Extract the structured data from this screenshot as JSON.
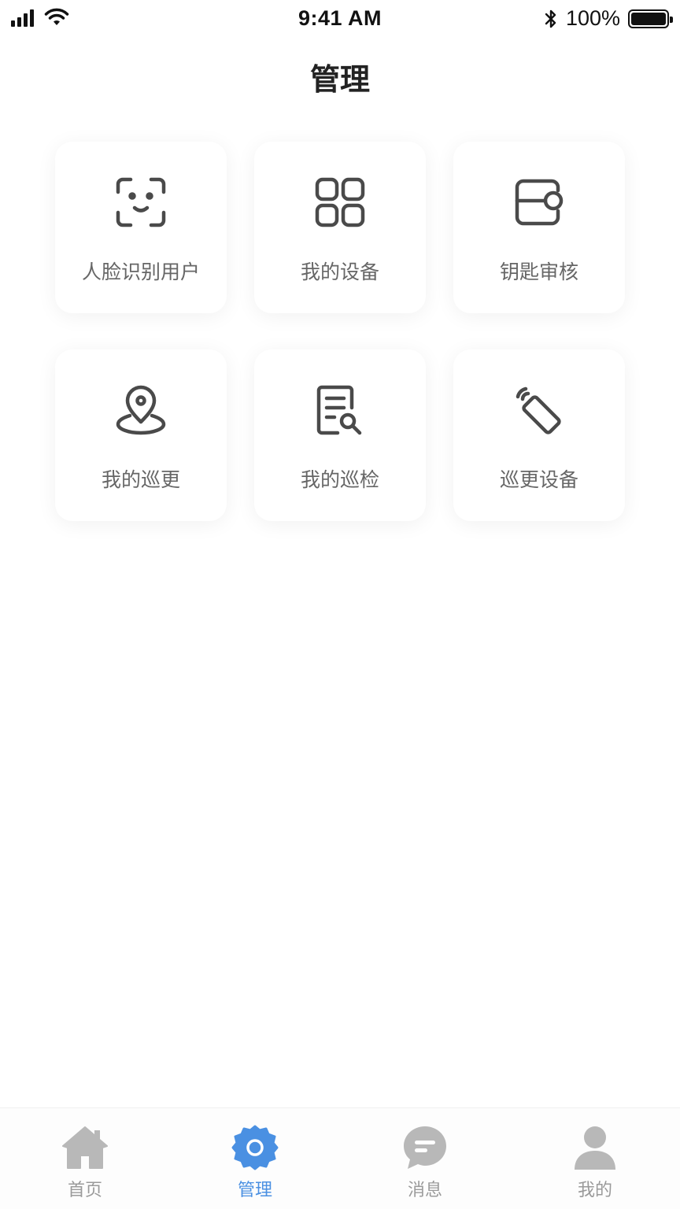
{
  "status_bar": {
    "time": "9:41 AM",
    "battery_text": "100%",
    "battery_level": 1.0,
    "signal_icon": "cellular-signal-icon",
    "wifi_icon": "wifi-icon",
    "bluetooth_icon": "bluetooth-icon"
  },
  "header": {
    "title": "管理"
  },
  "grid": {
    "items": [
      {
        "label": "人脸识别用户",
        "icon": "face-scan-icon"
      },
      {
        "label": "我的设备",
        "icon": "grid-apps-icon"
      },
      {
        "label": "钥匙审核",
        "icon": "key-card-icon"
      },
      {
        "label": "我的巡更",
        "icon": "location-pin-icon"
      },
      {
        "label": "我的巡检",
        "icon": "document-search-icon"
      },
      {
        "label": "巡更设备",
        "icon": "patrol-device-icon"
      }
    ]
  },
  "tab_bar": {
    "tabs": [
      {
        "label": "首页",
        "icon": "home-icon",
        "active": false
      },
      {
        "label": "管理",
        "icon": "gear-icon",
        "active": true
      },
      {
        "label": "消息",
        "icon": "chat-bubble-icon",
        "active": false
      },
      {
        "label": "我的",
        "icon": "user-icon",
        "active": false
      }
    ]
  },
  "colors": {
    "accent": "#4a90e2",
    "icon_gray": "#4a4a4a",
    "tab_inactive": "#b8b8b8"
  }
}
